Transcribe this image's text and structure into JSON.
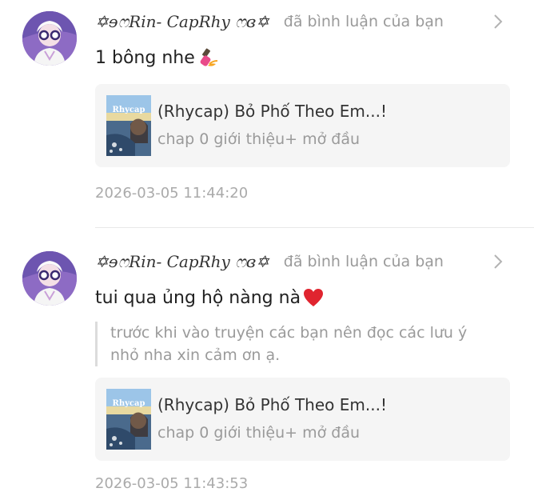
{
  "comments": [
    {
      "username": "✡ɘෆRin- CapRhy ෆɞ✡",
      "action": "đã bình luận của bạn",
      "text": "1 bông nhe",
      "text_emoji": "nail-polish-icon",
      "quote": "",
      "story": {
        "title": "(Rhycap) Bỏ Phố Theo Em...!",
        "subtitle": "chap 0 giới thiệu+ mở đầu",
        "cover_text": "Rhycap"
      },
      "timestamp": "2026-03-05 11:44:20"
    },
    {
      "username": "✡ɘෆRin- CapRhy ෆɞ✡",
      "action": "đã bình luận của bạn",
      "text": "tui qua ủng hộ nàng nà",
      "text_emoji": "red-heart-icon",
      "quote": "trước khi vào truyện các bạn nên đọc các  lưu ý nhỏ nha xin cảm ơn ạ.",
      "story": {
        "title": "(Rhycap) Bỏ Phố Theo Em...!",
        "subtitle": "chap 0 giới thiệu+ mở đầu",
        "cover_text": "Rhycap"
      },
      "timestamp": "2026-03-05 11:43:53"
    }
  ],
  "colors": {
    "username": "#333333",
    "secondary_text": "#9a9a9a",
    "card_background": "#f5f5f5",
    "heart": "#e0242f",
    "avatar_background": "#8d6bc4"
  }
}
